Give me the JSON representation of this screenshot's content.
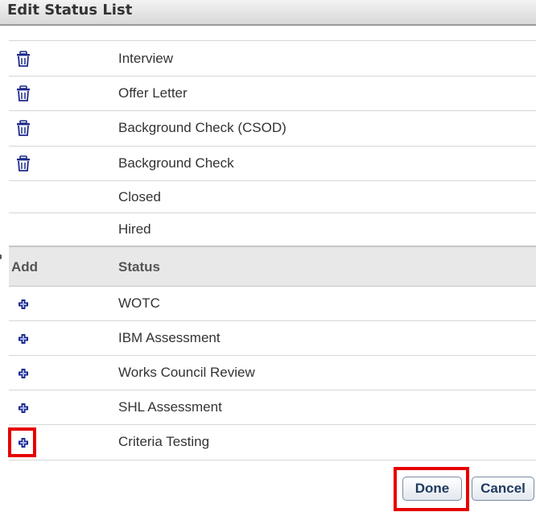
{
  "dialog": {
    "title": "Edit Status List"
  },
  "current_statuses": [
    {
      "label": "Interview",
      "deletable": true
    },
    {
      "label": "Offer Letter",
      "deletable": true
    },
    {
      "label": "Background Check (CSOD)",
      "deletable": true
    },
    {
      "label": "Background Check",
      "deletable": true
    },
    {
      "label": "Closed",
      "deletable": false
    },
    {
      "label": "Hired",
      "deletable": false
    }
  ],
  "available_table": {
    "headers": {
      "add": "Add",
      "status": "Status"
    },
    "rows": [
      {
        "label": "WOTC"
      },
      {
        "label": "IBM Assessment"
      },
      {
        "label": "Works Council Review"
      },
      {
        "label": "SHL Assessment"
      },
      {
        "label": "Criteria Testing"
      }
    ]
  },
  "footer": {
    "done_label": "Done",
    "cancel_label": "Cancel"
  },
  "colors": {
    "icon": "#1c2a8a",
    "highlight": "#e60000",
    "button_text": "#1f3a5f"
  },
  "icons": {
    "delete": "trash-icon",
    "add": "plus-icon"
  }
}
